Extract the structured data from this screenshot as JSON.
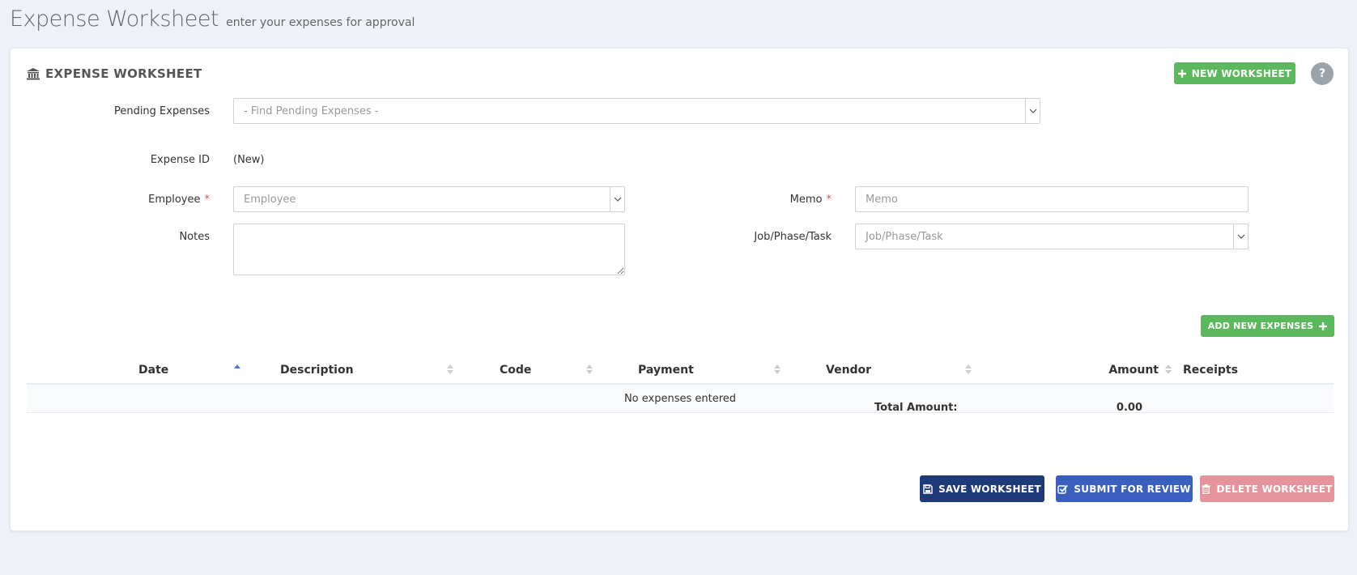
{
  "page": {
    "title": "Expense Worksheet",
    "subtitle": "enter your expenses for approval"
  },
  "panel": {
    "title": "EXPENSE WORKSHEET",
    "title_icon": "bank-icon",
    "new_worksheet_label": "NEW WORKSHEET",
    "help_label": "?"
  },
  "form": {
    "pending_label": "Pending Expenses",
    "pending_placeholder": "- Find Pending Expenses -",
    "expense_id_label": "Expense ID",
    "expense_id_value": "(New)",
    "employee_label": "Employee",
    "employee_placeholder": "Employee",
    "notes_label": "Notes",
    "notes_value": "",
    "memo_label": "Memo",
    "memo_placeholder": "Memo",
    "job_label": "Job/Phase/Task",
    "job_placeholder": "Job/Phase/Task",
    "required_mark": "*"
  },
  "add_expenses_label": "ADD NEW EXPENSES",
  "table": {
    "columns": [
      "Date",
      "Description",
      "Code",
      "Payment",
      "Vendor",
      "Amount",
      "Receipts"
    ],
    "empty_message": "No expenses entered",
    "total_label": "Total Amount:",
    "total_value": "0.00"
  },
  "actions": {
    "save_label": "SAVE WORKSHEET",
    "submit_label": "SUBMIT FOR REVIEW",
    "delete_label": "DELETE WORKSHEET"
  },
  "colors": {
    "background": "#eef1f8",
    "green": "#5cb85c",
    "save": "#1f3a78",
    "submit": "#3a5fbf",
    "delete": "#e4949a",
    "required": "#d9534f"
  }
}
